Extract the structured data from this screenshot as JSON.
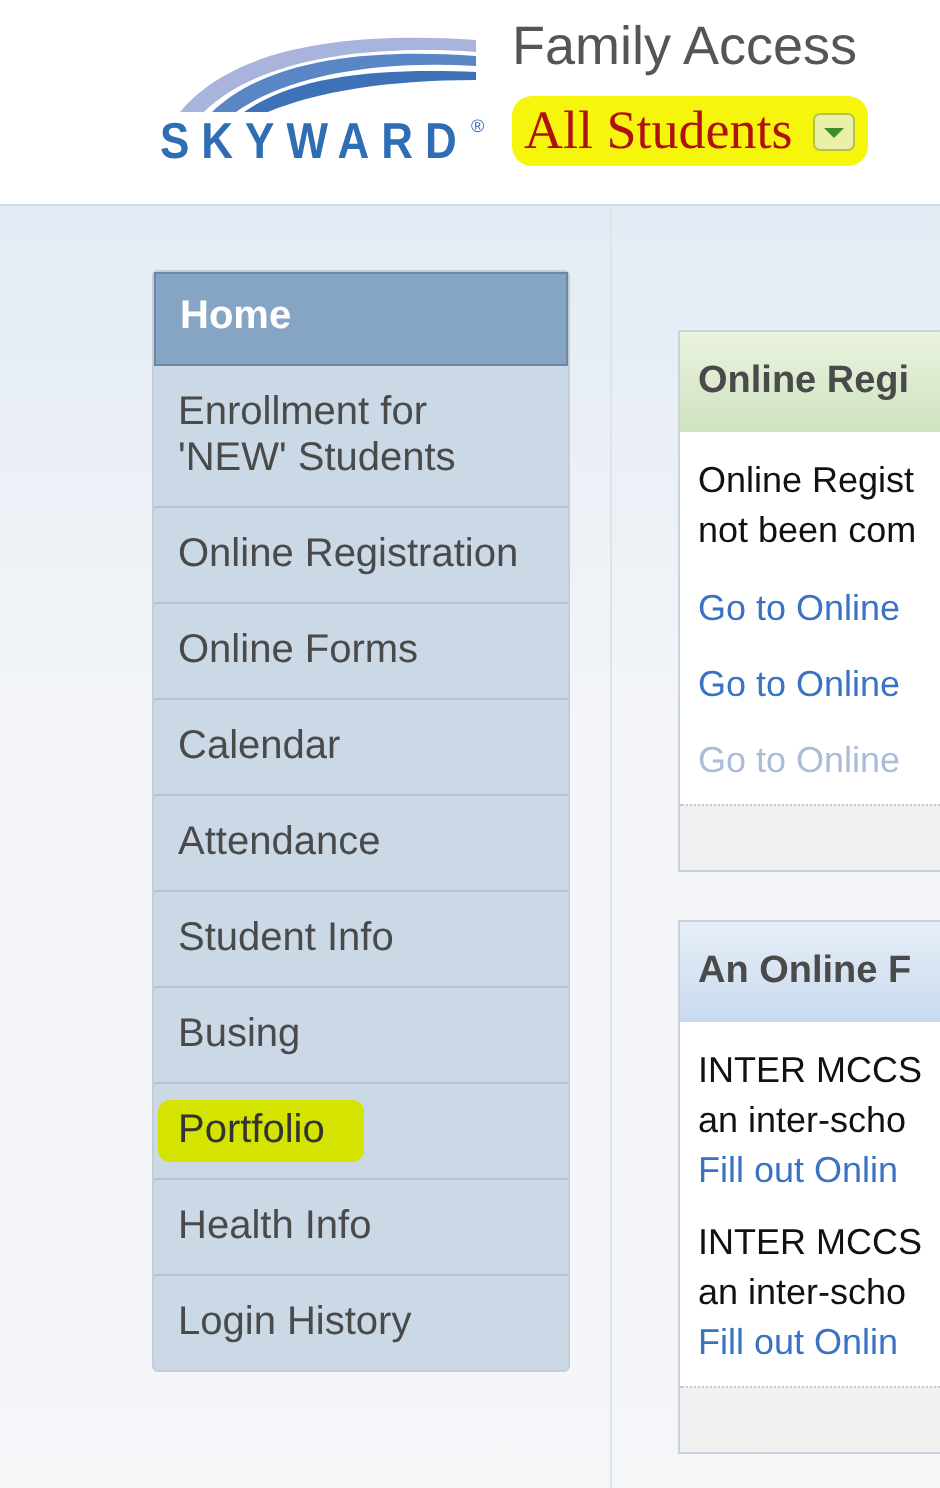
{
  "header": {
    "logo_text": "SKYWARD",
    "logo_mark": "®",
    "title": "Family Access",
    "student_selector": {
      "label": "All Students",
      "highlighted": true
    }
  },
  "sidebar": {
    "items": [
      {
        "label": "Home",
        "selected": true,
        "highlighted": false
      },
      {
        "label": "Enrollment for 'NEW' Students",
        "selected": false,
        "highlighted": false
      },
      {
        "label": "Online Registration",
        "selected": false,
        "highlighted": false
      },
      {
        "label": "Online Forms",
        "selected": false,
        "highlighted": false
      },
      {
        "label": "Calendar",
        "selected": false,
        "highlighted": false
      },
      {
        "label": "Attendance",
        "selected": false,
        "highlighted": false
      },
      {
        "label": "Student Info",
        "selected": false,
        "highlighted": false
      },
      {
        "label": "Busing",
        "selected": false,
        "highlighted": false
      },
      {
        "label": "Portfolio",
        "selected": false,
        "highlighted": true
      },
      {
        "label": "Health Info",
        "selected": false,
        "highlighted": false
      },
      {
        "label": "Login History",
        "selected": false,
        "highlighted": false
      }
    ]
  },
  "cards": [
    {
      "kind": "registration",
      "title": "Online Regi",
      "body": [
        "Online Regist",
        "not been com"
      ],
      "links": [
        {
          "label": "Go to Online",
          "faded": false
        },
        {
          "label": "Go to Online",
          "faded": false
        },
        {
          "label": "Go to Online",
          "faded": true
        }
      ]
    },
    {
      "kind": "forms",
      "title": "An Online F",
      "entries": [
        {
          "lines": [
            "INTER MCCS",
            "an inter-scho"
          ],
          "link": "Fill out Onlin"
        },
        {
          "lines": [
            "INTER MCCS",
            "an inter-scho"
          ],
          "link": "Fill out Onlin"
        }
      ]
    }
  ]
}
